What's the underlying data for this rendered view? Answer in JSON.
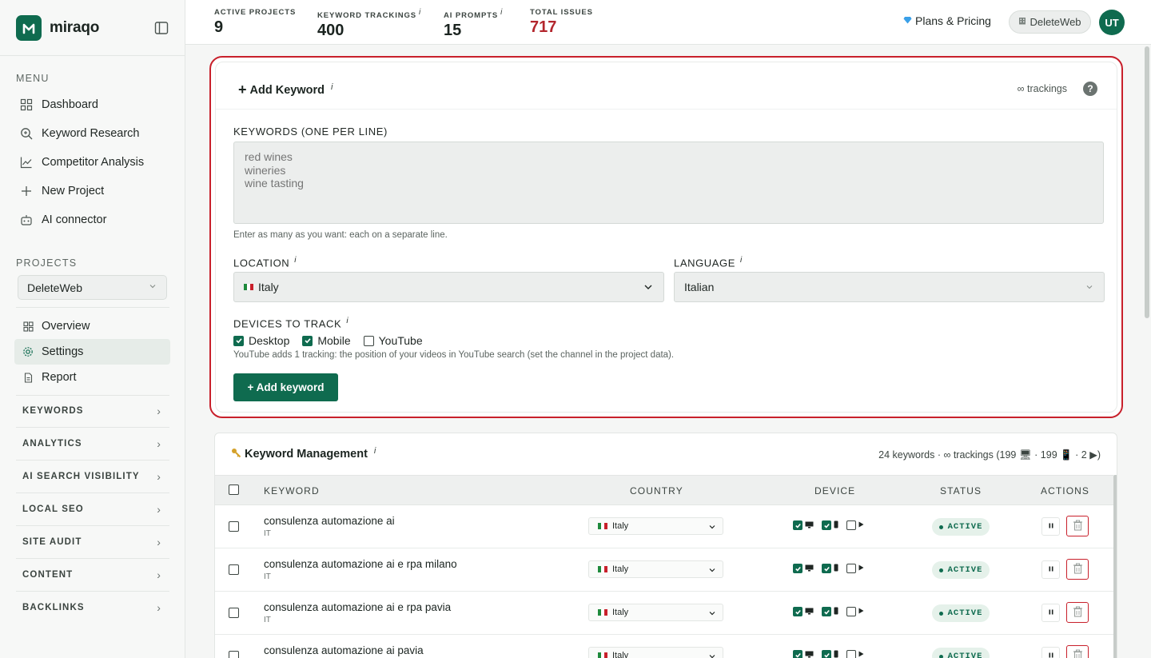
{
  "brand": {
    "name": "miraqo"
  },
  "sidebar": {
    "menu_title": "MENU",
    "menu": [
      {
        "label": "Dashboard",
        "icon": "grid-icon"
      },
      {
        "label": "Keyword Research",
        "icon": "search-icon"
      },
      {
        "label": "Competitor Analysis",
        "icon": "chart-line-icon"
      },
      {
        "label": "New Project",
        "icon": "plus-icon"
      },
      {
        "label": "AI connector",
        "icon": "robot-icon"
      }
    ],
    "projects_title": "PROJECTS",
    "project_selected": "DeleteWeb",
    "project_items": [
      {
        "label": "Overview",
        "icon": "grid-icon"
      },
      {
        "label": "Settings",
        "icon": "gear-icon"
      },
      {
        "label": "Report",
        "icon": "document-icon"
      }
    ],
    "groups": [
      "KEYWORDS",
      "ANALYTICS",
      "AI SEARCH VISIBILITY",
      "LOCAL SEO",
      "SITE AUDIT",
      "CONTENT",
      "BACKLINKS"
    ]
  },
  "topbar": {
    "stats": [
      {
        "label": "ACTIVE PROJECTS",
        "value": "9",
        "info": ""
      },
      {
        "label": "KEYWORD TRACKINGS",
        "value": "400",
        "info": "i"
      },
      {
        "label": "AI PROMPTS",
        "value": "15",
        "info": "i"
      },
      {
        "label": "TOTAL ISSUES",
        "value": "717",
        "info": ""
      }
    ],
    "plans_label": "Plans & Pricing",
    "project_pill": "DeleteWeb",
    "avatar_initials": "UT"
  },
  "add_keyword": {
    "title": "Add Keyword",
    "info": "i",
    "trackings_note": "∞ trackings",
    "help": "?",
    "keywords_label": "KEYWORDS (ONE PER LINE)",
    "keywords_placeholder": "red wines\nwineries\nwine tasting",
    "keywords_hint": "Enter as many as you want: each on a separate line.",
    "location_label": "LOCATION",
    "location_value": "Italy",
    "language_label": "LANGUAGE",
    "language_value": "Italian",
    "devices_label": "DEVICES TO TRACK",
    "devices": [
      {
        "label": "Desktop",
        "checked": true
      },
      {
        "label": "Mobile",
        "checked": true
      },
      {
        "label": "YouTube",
        "checked": false
      }
    ],
    "devices_hint": "YouTube adds 1 tracking: the position of your videos in YouTube search (set the channel in the project data).",
    "button_label": "+ Add keyword"
  },
  "keyword_management": {
    "title": "Keyword Management",
    "info": "i",
    "summary": "24 keywords · ∞ trackings (199 🖥 · 199 📱 · 2 ▶)",
    "columns": [
      "KEYWORD",
      "COUNTRY",
      "DEVICE",
      "STATUS",
      "ACTIONS"
    ],
    "rows": [
      {
        "keyword": "consulenza automazione ai",
        "code": "IT",
        "country": "Italy",
        "status": "ACTIVE"
      },
      {
        "keyword": "consulenza automazione ai e rpa milano",
        "code": "IT",
        "country": "Italy",
        "status": "ACTIVE"
      },
      {
        "keyword": "consulenza automazione ai e rpa pavia",
        "code": "IT",
        "country": "Italy",
        "status": "ACTIVE"
      },
      {
        "keyword": "consulenza automazione ai pavia",
        "code": "IT",
        "country": "Italy",
        "status": "ACTIVE"
      }
    ]
  },
  "colors": {
    "brand_green": "#0f6b4f",
    "issues_red": "#b3262d",
    "highlight_red": "#c8202b"
  }
}
